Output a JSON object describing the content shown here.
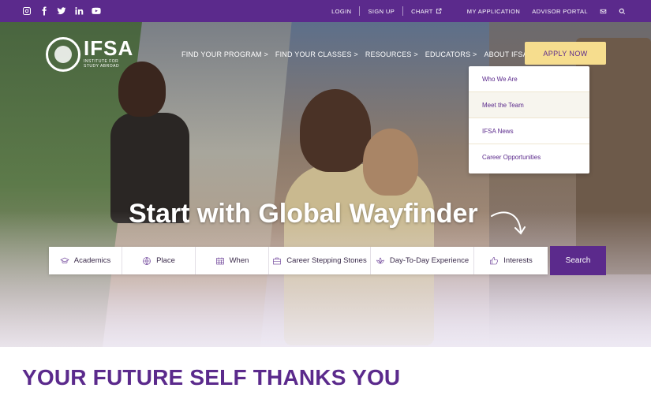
{
  "topbar": {
    "social_icons": [
      "instagram-icon",
      "facebook-icon",
      "twitter-icon",
      "linkedin-icon",
      "youtube-icon"
    ],
    "links": {
      "login": "LOGIN",
      "signup": "SIGN UP",
      "chart": "CHART",
      "my_application": "MY APPLICATION",
      "advisor_portal": "ADVISOR PORTAL"
    },
    "icons": [
      "external-link-icon",
      "mail-icon",
      "search-icon"
    ]
  },
  "logo": {
    "word": "IFSA",
    "sub_line1": "INSTITUTE FOR",
    "sub_line2": "STUDY ABROAD"
  },
  "nav": {
    "items": [
      {
        "label": "FIND YOUR PROGRAM >"
      },
      {
        "label": "FIND YOUR CLASSES >"
      },
      {
        "label": "RESOURCES >"
      },
      {
        "label": "EDUCATORS >"
      },
      {
        "label": "ABOUT IFSA >"
      }
    ],
    "apply": "APPLY NOW"
  },
  "dropdown": {
    "items": [
      {
        "label": "Who We Are"
      },
      {
        "label": "Meet the Team"
      },
      {
        "label": "IFSA News"
      },
      {
        "label": "Career Opportunities"
      }
    ]
  },
  "hero": {
    "headline": "Start with Global Wayfinder"
  },
  "search": {
    "filters": [
      {
        "label": "Academics",
        "icon": "graduation-cap-icon"
      },
      {
        "label": "Place",
        "icon": "globe-icon"
      },
      {
        "label": "When",
        "icon": "calendar-icon"
      },
      {
        "label": "Career Stepping Stones",
        "icon": "briefcase-icon"
      },
      {
        "label": "Day-To-Day Experience",
        "icon": "lotus-icon"
      },
      {
        "label": "Interests",
        "icon": "thumbs-up-icon"
      }
    ],
    "button": "Search"
  },
  "section": {
    "title": "YOUR FUTURE SELF THANKS YOU"
  },
  "colors": {
    "brand_purple": "#5b2a8c",
    "apply_yellow": "#f6dd8e",
    "white": "#ffffff"
  }
}
